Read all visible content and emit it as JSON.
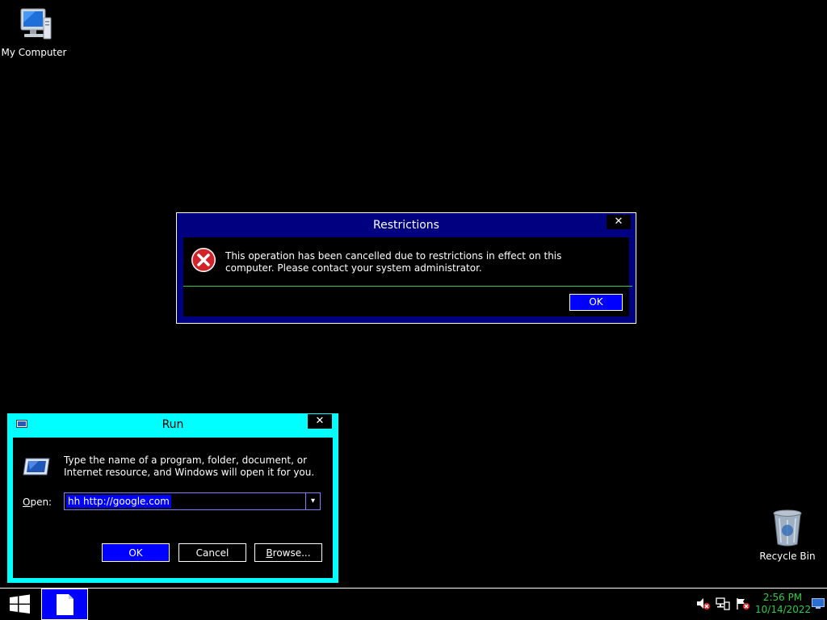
{
  "desktop": {
    "icons": [
      {
        "label": "My Computer",
        "icon": "computer-icon"
      },
      {
        "label": "Recycle Bin",
        "icon": "recycle-bin-icon"
      }
    ]
  },
  "restrictions_dialog": {
    "title": "Restrictions",
    "close_glyph": "✕",
    "icon": "error-icon",
    "message": "This operation has been cancelled due to restrictions in effect on this computer. Please contact your system administrator.",
    "ok_label": "OK"
  },
  "run_dialog": {
    "title": "Run",
    "close_glyph": "✕",
    "description": "Type the name of a program, folder, document, or Internet resource, and Windows will open it for you.",
    "open_label_accel": "O",
    "open_label_rest": "pen:",
    "open_value": "hh http://google.com",
    "dropdown_glyph": "▾",
    "ok_label": "OK",
    "cancel_label": "Cancel",
    "browse_label_accel": "B",
    "browse_label_rest": "rowse..."
  },
  "taskbar": {
    "start_icon": "windows-logo-icon",
    "task_item_icon": "document-icon",
    "tray_icons": [
      "volume-muted-icon",
      "network-icon",
      "action-center-icon"
    ],
    "clock_time": "2:56 PM",
    "clock_date": "10/14/2022"
  },
  "colors": {
    "desktop_bg": "#000000",
    "dialog_accent": "#000080",
    "run_frame": "#00ffff",
    "button_primary": "#0000ff",
    "separator": "#2ecc40",
    "clock_text": "#2ecc40"
  }
}
